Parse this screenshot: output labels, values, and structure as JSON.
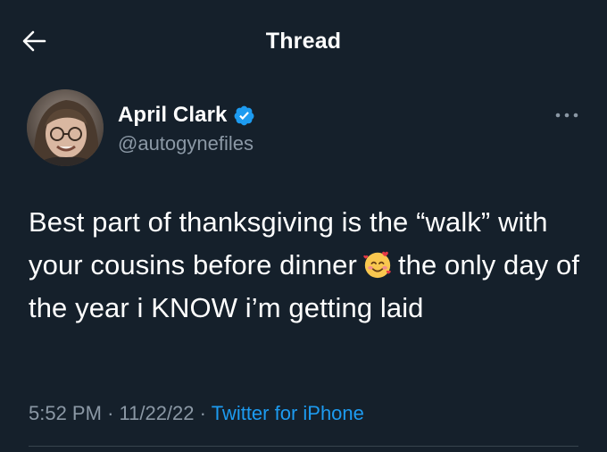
{
  "header": {
    "title": "Thread",
    "back_icon": "arrow-left-icon"
  },
  "author": {
    "name": "April Clark",
    "handle": "@autogynefiles",
    "verified_icon": "verified-badge-icon",
    "more_icon": "more-options-icon"
  },
  "tweet": {
    "text_part1": "Best part of thanksgiving is the “walk” with your cousins before dinner",
    "emoji": "smiling-face-with-hearts-icon",
    "text_part2": "the only day of the year i KNOW i’m getting laid"
  },
  "meta": {
    "time": "5:52 PM",
    "sep1": "·",
    "date": "11/22/22",
    "sep2": "·",
    "source": "Twitter for iPhone"
  },
  "colors": {
    "background": "#15202b",
    "accent": "#1d9bf0",
    "secondary_text": "#8b98a5"
  }
}
